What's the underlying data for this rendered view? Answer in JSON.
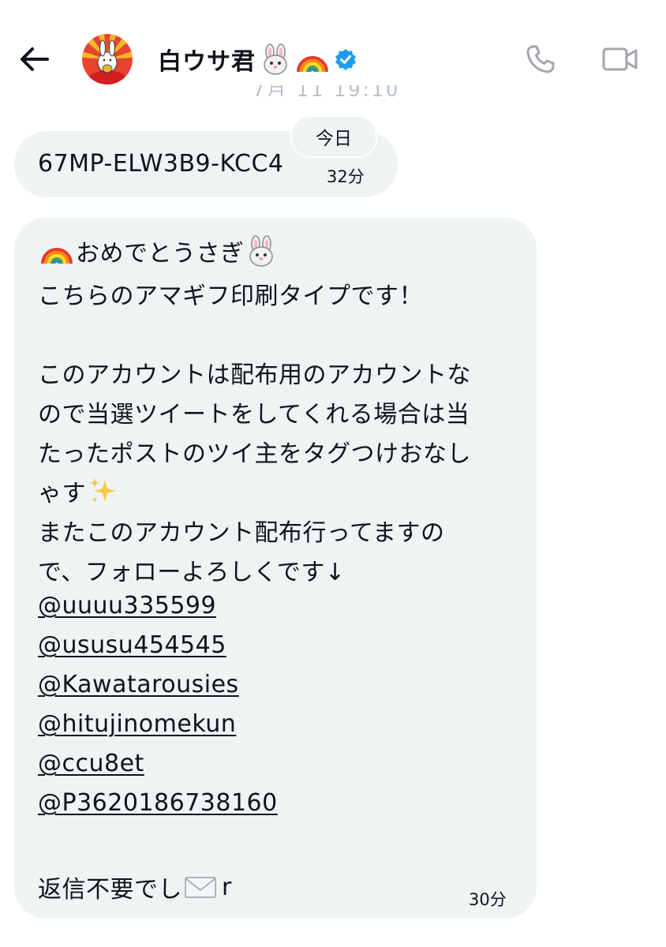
{
  "header": {
    "back_icon": "arrow-left-icon",
    "contact_name": "白ウサ君",
    "name_emojis": [
      "rabbit-face-icon",
      "rainbow-icon"
    ],
    "verified_icon": "verified-badge-icon",
    "verified_color": "#1d9bf0",
    "phone_icon": "phone-icon",
    "video_icon": "video-camera-icon"
  },
  "day_separator": "今日",
  "messages": [
    {
      "text": "67MP-ELW3B9-KCC4",
      "time": "32分"
    },
    {
      "lines": [
        "おめでとうさぎ",
        "こちらのアマギフ印刷タイプです！",
        "",
        "このアカウントは配布用のアカウントな",
        "ので当選ツイートをしてくれる場合は当",
        "たったポストのツイ主をタグつけおなし",
        "ゃす",
        "またこのアカウント配布行ってますの",
        "で、フォローよろしくです↓",
        "@uuuu335599",
        "@ususu454545",
        "@Kawatarousies",
        "@hitujinomekun",
        "@ccu8et",
        "@P3620186738160",
        "",
        "返信不要でし",
        "r"
      ],
      "time": "30分"
    }
  ],
  "colors": {
    "bubble_bg": "#eff3f4",
    "text": "#0f1419",
    "icon_gray": "#a0a6ab"
  }
}
